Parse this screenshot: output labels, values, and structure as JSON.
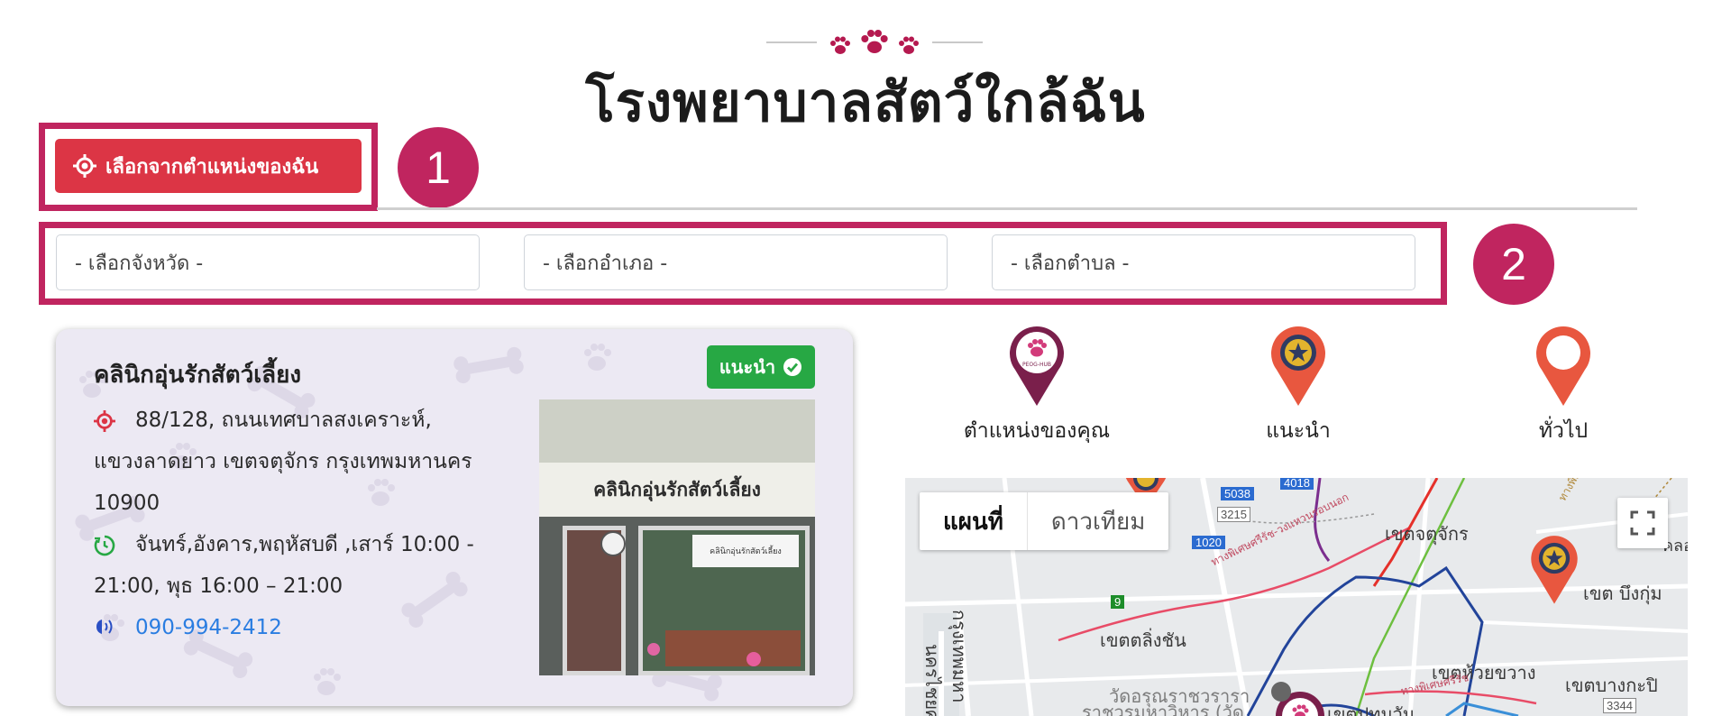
{
  "page": {
    "title": "โรงพยาบาลสัตว์ใกล้ฉัน"
  },
  "location_button": {
    "label": "เลือกจากตำแหน่งของฉัน",
    "icon": "crosshair-icon"
  },
  "annotations": {
    "badge_1": "1",
    "badge_2": "2"
  },
  "filters": {
    "province_placeholder": "- เลือกจังหวัด -",
    "district_placeholder": "- เลือกอำเภอ -",
    "subdistrict_placeholder": "- เลือกตำบล -"
  },
  "clinic": {
    "name": "คลินิกอุ่นรักสัตว์เลี้ยง",
    "badge": "แนะนำ",
    "address_line1": "88/128, ถนนเทศบาลสงเคราะห์,",
    "address_line2": "แขวงลาดยาว เขตจตุจักร กรุงเทพมหานคร",
    "address_line3": "10900",
    "hours_line1": "จันทร์,อังคาร,พฤหัสบดี ,เสาร์ 10:00 -",
    "hours_line2": "21:00, พุธ 16:00 – 21:00",
    "phone": "090-994-2412",
    "photo_sign": "คลินิกอุ่นรักสัตว์เลี้ยง",
    "photo_small_sign": "คลินิกอุ่นรักสัตว์เลี้ยง"
  },
  "legend": {
    "your_location": "ตำแหน่งของคุณ",
    "recommended": "แนะนำ",
    "general": "ทั่วไป",
    "pin_logo_text": "PEOG-HUB"
  },
  "map": {
    "tab_map": "แผนที่",
    "tab_satellite": "ดาวเทียม",
    "labels": {
      "chatuchak": "เขตจตุจักร",
      "bueng_kum": "เขต บึงกุ่ม",
      "taling_chan": "เขตตลิ่งชัน",
      "huai_khwang": "เขตห้วยขวาง",
      "bang_kapi": "เขตบางกะปิ",
      "wat_arun": "วัดอรุณราชวรารา",
      "wat_arun2": "ราชวรมหาวิหาร (วัด",
      "expressway": "ทางพิเศษศรีรัช-วงแหวนรอบนอก",
      "expressway2": "ทางพิเศษศรีรัช",
      "expressway3": "ทางพิเศษศรีรัช",
      "bangkok_vertical": "กรุงเทพมหา",
      "nonthaburi_vertical": "นครไชยศรี",
      "pathum": "เขตปทุมวัน",
      "klong": "คลองจั่น"
    },
    "road_shields": [
      "5038",
      "4018",
      "3215",
      "1020",
      "9",
      "3344"
    ],
    "colors": {
      "green": "#6dbf3f",
      "blue": "#22449a",
      "red": "#e5302a",
      "purple": "#7b2d8e",
      "pink_route": "#e84c67"
    }
  },
  "colors": {
    "primary_red": "#dc3545",
    "annotation": "#c0255f",
    "badge_green": "#27a844",
    "pin_dark": "#7a1f4b",
    "pin_orange": "#e8573f",
    "phone_blue": "#2a7de1"
  }
}
